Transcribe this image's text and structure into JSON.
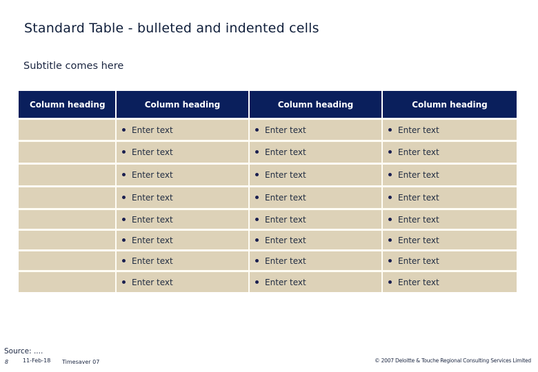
{
  "title": "Standard Table - bulleted and indented cells",
  "subtitle": "Subtitle comes here",
  "table": {
    "headers": [
      "Column heading",
      "Column heading",
      "Column heading",
      "Column heading"
    ],
    "rows": [
      [
        "",
        "Enter text",
        "Enter text",
        "Enter text"
      ],
      [
        "",
        "Enter text",
        "Enter text",
        "Enter text"
      ],
      [
        "",
        "Enter text",
        "Enter text",
        "Enter text"
      ],
      [
        "",
        "Enter text",
        "Enter text",
        "Enter text"
      ],
      [
        "",
        "Enter text",
        "Enter text",
        "Enter text"
      ],
      [
        "",
        "Enter text",
        "Enter text",
        "Enter text"
      ],
      [
        "",
        "Enter text",
        "Enter text",
        "Enter text"
      ],
      [
        "",
        "Enter text",
        "Enter text",
        "Enter text"
      ]
    ],
    "colors": {
      "header_bg": "#0a1f5c",
      "cell_bg": "#ddd2b8"
    }
  },
  "footer": {
    "source": "Source: ....",
    "page_number": "8",
    "date": "11-Feb-18",
    "version": "Timesaver 07",
    "copyright": "© 2007 Deloitte & Touche Regional Consulting Services Limited"
  }
}
